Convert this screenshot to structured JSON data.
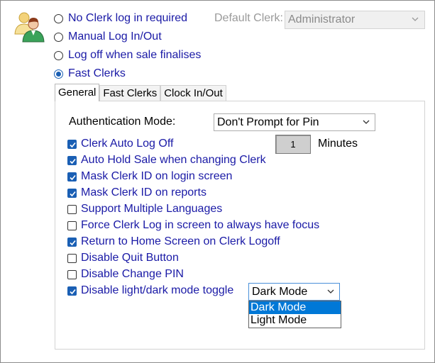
{
  "login_modes": [
    {
      "label": "No Clerk log in required",
      "checked": false
    },
    {
      "label": "Manual Log In/Out",
      "checked": false
    },
    {
      "label": "Log off when sale finalises",
      "checked": false
    },
    {
      "label": "Fast Clerks",
      "checked": true
    }
  ],
  "default_clerk": {
    "label": "Default Clerk:",
    "value": "Administrator",
    "enabled": false
  },
  "tabs": [
    {
      "label": "General",
      "active": true
    },
    {
      "label": "Fast Clerks",
      "active": false
    },
    {
      "label": "Clock In/Out",
      "active": false
    }
  ],
  "general": {
    "auth_mode_label": "Authentication Mode:",
    "auth_mode_value": "Don't Prompt for Pin",
    "minutes_value": "1",
    "minutes_label": "Minutes",
    "options": [
      {
        "label": "Clerk Auto Log Off",
        "checked": true
      },
      {
        "label": "Auto Hold Sale when changing Clerk",
        "checked": true
      },
      {
        "label": "Mask Clerk ID on login screen",
        "checked": true
      },
      {
        "label": "Mask Clerk ID on reports",
        "checked": true
      },
      {
        "label": "Support Multiple Languages",
        "checked": false
      },
      {
        "label": "Force Clerk Log in screen to always have focus",
        "checked": false
      },
      {
        "label": "Return to Home Screen on Clerk Logoff",
        "checked": true
      },
      {
        "label": "Disable Quit Button",
        "checked": false
      },
      {
        "label": "Disable Change PIN",
        "checked": false
      },
      {
        "label": "Disable light/dark mode toggle",
        "checked": true
      }
    ],
    "mode_select": {
      "value": "Dark Mode",
      "options": [
        "Dark Mode",
        "Light Mode"
      ],
      "highlighted": "Dark Mode"
    }
  },
  "colors": {
    "label_blue": "#1a1aa6",
    "check_blue": "#1a5fb4",
    "highlight": "#0078d7",
    "disabled_text": "#9a9a9a"
  }
}
